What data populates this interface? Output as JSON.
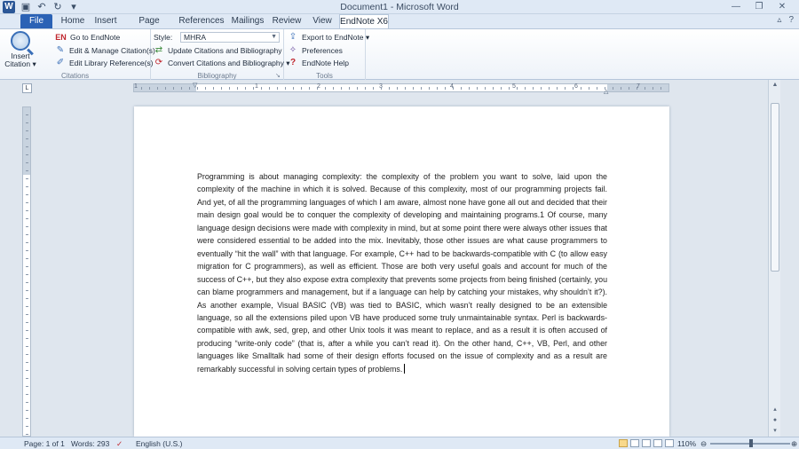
{
  "window": {
    "title": "Document1 - Microsoft Word",
    "app_icon": "W"
  },
  "tabs": [
    {
      "label": "File"
    },
    {
      "label": "Home"
    },
    {
      "label": "Insert"
    },
    {
      "label": "Page Layout"
    },
    {
      "label": "References"
    },
    {
      "label": "Mailings"
    },
    {
      "label": "Review"
    },
    {
      "label": "View"
    },
    {
      "label": "EndNote X6"
    }
  ],
  "ribbon": {
    "citations": {
      "group_label": "Citations",
      "insert_citation": "Insert Citation",
      "insert_citation_line1": "Insert",
      "insert_citation_line2": "Citation ▾",
      "go_to_endnote": "Go to EndNote",
      "go_to_endnote_badge": "EN",
      "edit_manage": "Edit & Manage Citation(s)",
      "edit_library": "Edit Library Reference(s)"
    },
    "bibliography": {
      "group_label": "Bibliography",
      "style_label": "Style:",
      "style_value": "MHRA",
      "update": "Update Citations and Bibliography",
      "convert": "Convert Citations and Bibliography ▾"
    },
    "tools": {
      "group_label": "Tools",
      "export": "Export to EndNote ▾",
      "preferences": "Preferences",
      "help": "EndNote Help"
    }
  },
  "ruler": {
    "numbers": [
      "1",
      "1",
      "2",
      "3",
      "4",
      "5",
      "6",
      "7"
    ]
  },
  "document": {
    "text": "Programming is about managing complexity: the complexity of the problem you want to solve, laid upon the complexity of the machine in which it is solved. Because of this complexity, most of our programming projects fail. And yet, of all the programming languages of which I am aware, almost none have gone all out and decided that their main design goal would be to conquer the complexity of developing and maintaining programs.1 Of course, many language design decisions were made with complexity in mind, but at some point there were always other issues that were considered essential to be added into the mix. Inevitably, those other issues are what cause programmers to eventually “hit the wall” with that language. For example, C++ had to be backwards-compatible with C (to allow easy migration for C programmers), as well as efficient. Those are both very useful goals and account for much of the success of C++, but they also expose extra complexity that prevents some projects from being finished (certainly, you can blame programmers and management, but if a language can help by catching your mistakes, why shouldn’t it?). As another example, Visual BASIC (VB) was tied to BASIC, which wasn’t really designed to be an extensible language, so all the extensions piled upon VB have produced some truly unmaintainable syntax. Perl is backwards-compatible with awk, sed, grep, and other Unix tools it was meant to replace, and as a result it is often accused of producing “write-only code” (that is, after a while you can’t read it). On the other hand, C++, VB, Perl, and other languages like Smalltalk had some of their design efforts focused on the issue of complexity and as a result are remarkably successful in solving certain types of problems."
  },
  "statusbar": {
    "page": "Page: 1 of 1",
    "words": "Words: 293",
    "language": "English (U.S.)",
    "zoom": "110%",
    "zoom_level_percent": 110
  },
  "colors": {
    "file_tab": "#2b62b5",
    "accent": "#3a6fb8"
  }
}
